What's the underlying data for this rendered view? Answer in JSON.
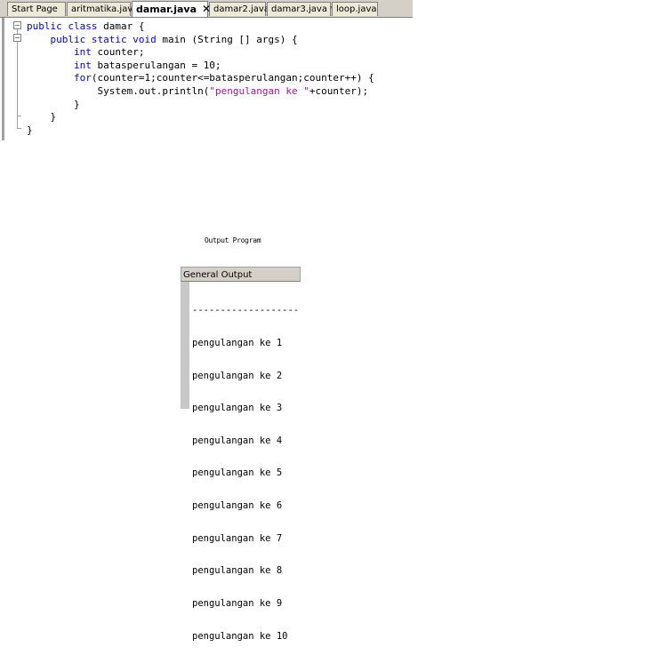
{
  "editor": {
    "tabs": [
      {
        "label": "Start Page"
      },
      {
        "label": "aritmatika.java"
      },
      {
        "label": "damar.java"
      },
      {
        "label": "damar2.java"
      },
      {
        "label": "damar3.java *"
      },
      {
        "label": "loop.java"
      }
    ],
    "active_tab_close": "✕",
    "code": {
      "l1_kw": "public class",
      "l1_rest": " damar {",
      "l2_kw": "public static void",
      "l2_rest": " main (String [] args) {",
      "l3_kw": "int",
      "l3_rest": " counter;",
      "l4_kw": "int",
      "l4_rest": " batasperulangan = 10;",
      "l5_kw": "for",
      "l5_rest": "(counter=1;counter<=batasperulangan;counter++) {",
      "l6_a": "System.out.println(",
      "l6_str": "\"pengulangan ke \"",
      "l6_b": "+counter);",
      "l7": "}",
      "l8": "}",
      "l9": "}"
    }
  },
  "caption": "Output Program",
  "output": {
    "title": "General Output",
    "lines": [
      "-------------------",
      "pengulangan ke 1",
      "pengulangan ke 2",
      "pengulangan ke 3",
      "pengulangan ke 4",
      "pengulangan ke 5",
      "pengulangan ke 6",
      "pengulangan ke 7",
      "pengulangan ke 8",
      "pengulangan ke 9",
      "pengulangan ke 10"
    ]
  }
}
